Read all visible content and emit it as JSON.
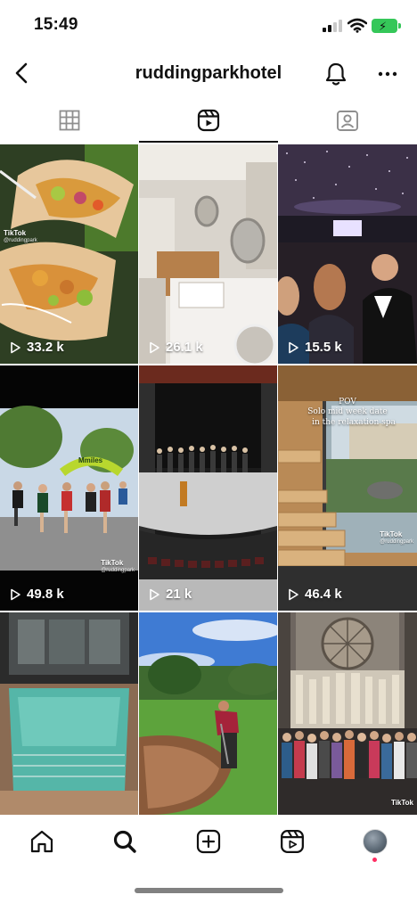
{
  "status_bar": {
    "time": "15:49"
  },
  "header": {
    "title": "ruddingparkhotel"
  },
  "tabs": [
    {
      "name": "posts-grid",
      "icon": "grid-icon",
      "active": false
    },
    {
      "name": "reels",
      "icon": "reels-icon",
      "active": true
    },
    {
      "name": "tagged",
      "icon": "tagged-person-icon",
      "active": false
    }
  ],
  "reels": [
    {
      "views": "33.2 k",
      "scene": "tacos",
      "watermark": {
        "brand": "TikTok",
        "handle": "@ruddingpark"
      }
    },
    {
      "views": "26.1 k",
      "scene": "salon"
    },
    {
      "views": "15.5 k",
      "scene": "event-marquee"
    },
    {
      "views": "49.8 k",
      "scene": "running-race",
      "banner": "Mmiles",
      "watermark": {
        "brand": "TikTok",
        "handle": "@ruddingpark"
      }
    },
    {
      "views": "21 k",
      "scene": "theatre"
    },
    {
      "views": "46.4 k",
      "scene": "sauna",
      "caption": [
        "POV",
        "Solo mid week date",
        "in the",
        "relaxation spa"
      ],
      "watermark": {
        "brand": "TikTok",
        "handle": "@ruddingpark"
      }
    },
    {
      "views": "",
      "scene": "indoor-pool"
    },
    {
      "views": "",
      "scene": "golf-bunker"
    },
    {
      "views": "",
      "scene": "cathedral-choir",
      "watermark": {
        "brand": "TikTok",
        "handle": ""
      }
    }
  ],
  "bottom_nav": [
    {
      "name": "home",
      "icon": "home-icon"
    },
    {
      "name": "search",
      "icon": "search-icon",
      "active": true
    },
    {
      "name": "create",
      "icon": "plus-square-icon"
    },
    {
      "name": "reels",
      "icon": "reels-icon"
    },
    {
      "name": "profile",
      "icon": "avatar"
    }
  ],
  "colors": {
    "battery": "#35c759",
    "notification_dot": "#ff2e63",
    "text": "#111111"
  }
}
